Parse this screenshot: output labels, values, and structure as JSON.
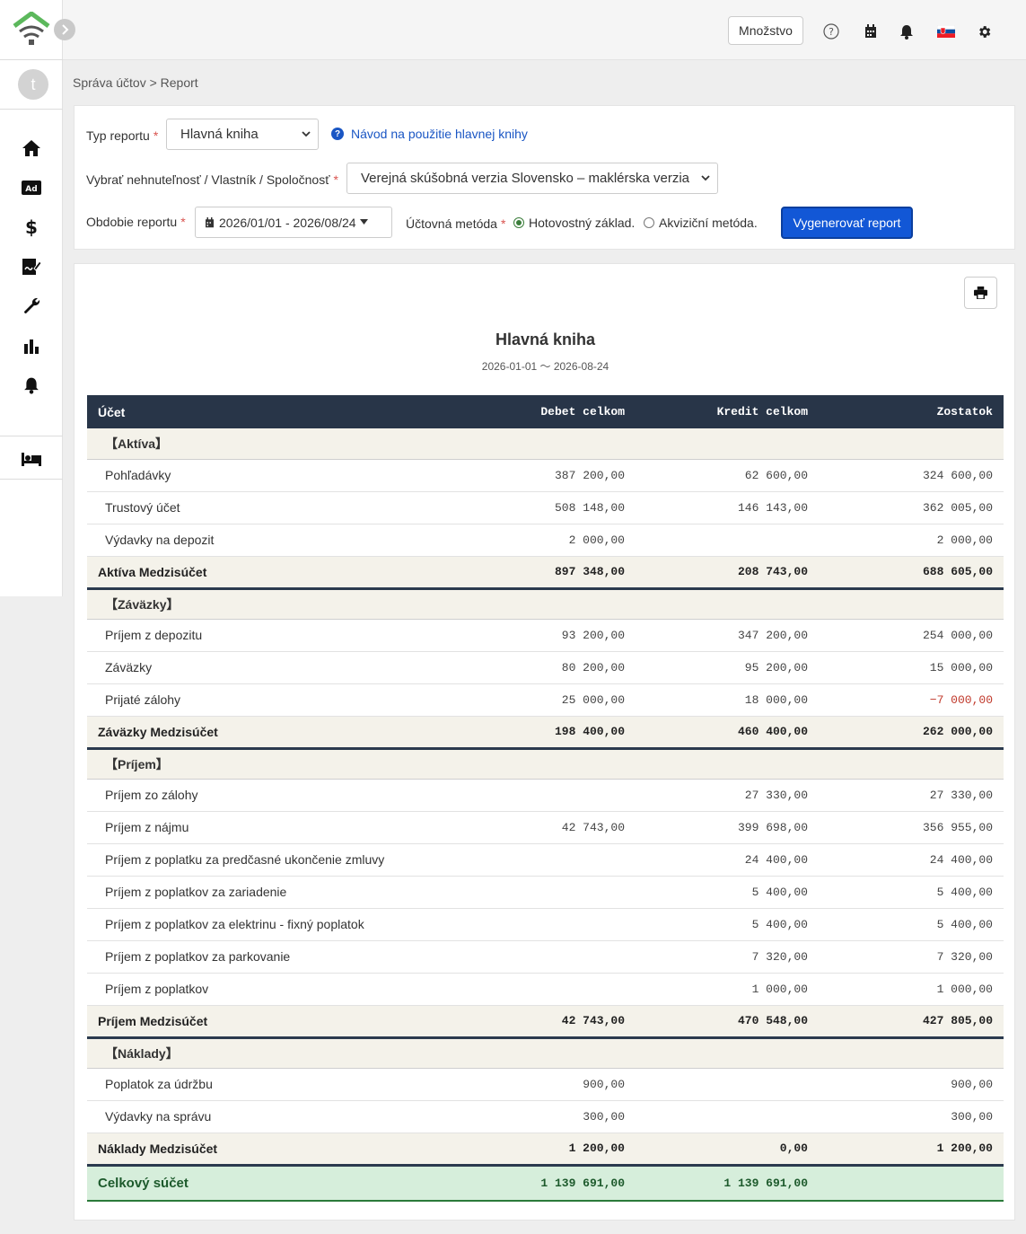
{
  "header": {
    "qty_button": "Množstvo"
  },
  "sidebar": {
    "avatar_initial": "t",
    "items": [
      {
        "name": "home-icon"
      },
      {
        "name": "ad-icon",
        "label": "Ad"
      },
      {
        "name": "dollar-icon"
      },
      {
        "name": "contract-icon"
      },
      {
        "name": "wrench-icon"
      },
      {
        "name": "bar-chart-icon"
      },
      {
        "name": "bell-icon"
      },
      {
        "name": "bed-icon"
      }
    ]
  },
  "breadcrumb": "Správa účtov > Report",
  "filters": {
    "report_type_label": "Typ reportu",
    "report_type_value": "Hlavná kniha",
    "help_link": "Návod na použitie hlavnej knihy",
    "property_label": "Vybrať nehnuteľnosť / Vlastník / Spoločnosť",
    "property_value": "Verejná skúšobná verzia Slovensko – maklérska verzia",
    "period_label": "Obdobie reportu",
    "period_value": "2026/01/01 - 2026/08/24",
    "method_label": "Účtovná metóda",
    "method_cash": "Hotovostný základ.",
    "method_accrual": "Akviziční metóda.",
    "method_selected": "cash",
    "generate_button": "Vygenerovať report"
  },
  "report": {
    "title": "Hlavná kniha",
    "range": "2026-01-01 〜 2026-08-24",
    "columns": [
      "Účet",
      "Debet celkom",
      "Kredit celkom",
      "Zostatok"
    ],
    "groups": [
      {
        "name": "【Aktíva】",
        "rows": [
          {
            "account": "Pohľadávky",
            "debit": "387 200,00",
            "credit": "62 600,00",
            "balance": "324 600,00"
          },
          {
            "account": "Trustový účet",
            "debit": "508 148,00",
            "credit": "146 143,00",
            "balance": "362 005,00"
          },
          {
            "account": "Výdavky na depozit",
            "debit": "2 000,00",
            "credit": "",
            "balance": "2 000,00"
          }
        ],
        "subtotal": {
          "label": "Aktíva Medzisúčet",
          "debit": "897 348,00",
          "credit": "208 743,00",
          "balance": "688 605,00"
        }
      },
      {
        "name": "【Záväzky】",
        "rows": [
          {
            "account": "Príjem z depozitu",
            "debit": "93 200,00",
            "credit": "347 200,00",
            "balance": "254 000,00"
          },
          {
            "account": "Záväzky",
            "debit": "80 200,00",
            "credit": "95 200,00",
            "balance": "15 000,00"
          },
          {
            "account": "Prijaté zálohy",
            "debit": "25 000,00",
            "credit": "18 000,00",
            "balance": "−7 000,00"
          }
        ],
        "subtotal": {
          "label": "Záväzky Medzisúčet",
          "debit": "198 400,00",
          "credit": "460 400,00",
          "balance": "262 000,00"
        }
      },
      {
        "name": "【Príjem】",
        "rows": [
          {
            "account": "Príjem zo zálohy",
            "debit": "",
            "credit": "27 330,00",
            "balance": "27 330,00"
          },
          {
            "account": "Príjem z nájmu",
            "debit": "42 743,00",
            "credit": "399 698,00",
            "balance": "356 955,00"
          },
          {
            "account": "Príjem z poplatku za predčasné ukončenie zmluvy",
            "debit": "",
            "credit": "24 400,00",
            "balance": "24 400,00"
          },
          {
            "account": "Príjem z poplatkov za zariadenie",
            "debit": "",
            "credit": "5 400,00",
            "balance": "5 400,00"
          },
          {
            "account": "Príjem z poplatkov za elektrinu - fixný poplatok",
            "debit": "",
            "credit": "5 400,00",
            "balance": "5 400,00"
          },
          {
            "account": "Príjem z poplatkov za parkovanie",
            "debit": "",
            "credit": "7 320,00",
            "balance": "7 320,00"
          },
          {
            "account": "Príjem z poplatkov",
            "debit": "",
            "credit": "1 000,00",
            "balance": "1 000,00"
          }
        ],
        "subtotal": {
          "label": "Príjem Medzisúčet",
          "debit": "42 743,00",
          "credit": "470 548,00",
          "balance": "427 805,00"
        }
      },
      {
        "name": "【Náklady】",
        "rows": [
          {
            "account": "Poplatok za údržbu",
            "debit": "900,00",
            "credit": "",
            "balance": "900,00"
          },
          {
            "account": "Výdavky na správu",
            "debit": "300,00",
            "credit": "",
            "balance": "300,00"
          }
        ],
        "subtotal": {
          "label": "Náklady Medzisúčet",
          "debit": "1 200,00",
          "credit": "0,00",
          "balance": "1 200,00"
        }
      }
    ],
    "total": {
      "label": "Celkový súčet",
      "debit": "1 139 691,00",
      "credit": "1 139 691,00",
      "balance": ""
    }
  }
}
